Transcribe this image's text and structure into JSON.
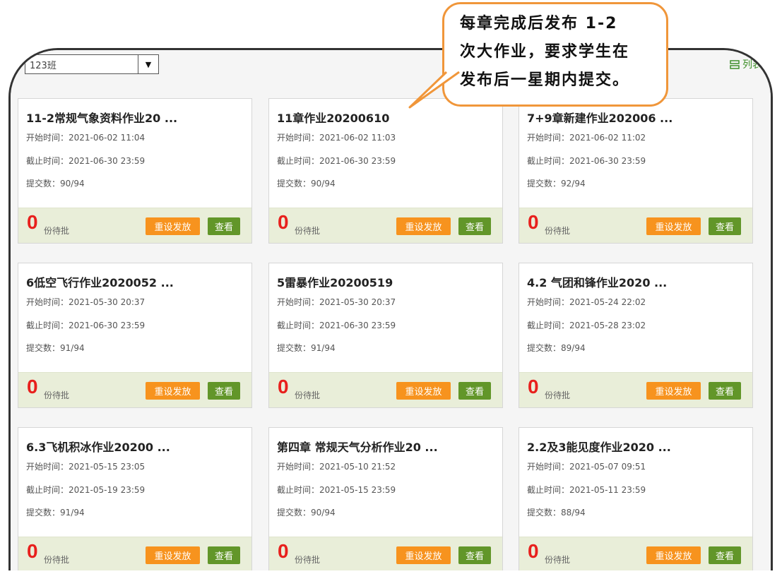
{
  "toolbar": {
    "class_select_value": "123班",
    "list_view_label": "列表"
  },
  "callout": {
    "lines": [
      "每章完成后发布 1-2",
      "次大作业，要求学生在",
      "发布后一星期内提交。"
    ]
  },
  "labels": {
    "start_prefix": "开始时间：",
    "end_prefix": "截止时间：",
    "submit_prefix": "提交数：",
    "pending_suffix": "份待批",
    "reset_button": "重设发放",
    "view_button": "查看"
  },
  "assignments": [
    {
      "title": "11-2常规气象资料作业20 ...",
      "start": "2021-06-02 11:04",
      "end": "2021-06-30 23:59",
      "submitted": "90/94",
      "pending": "0"
    },
    {
      "title": "11章作业20200610",
      "start": "2021-06-02 11:03",
      "end": "2021-06-30 23:59",
      "submitted": "90/94",
      "pending": "0"
    },
    {
      "title": "7+9章新建作业202006 ...",
      "start": "2021-06-02 11:02",
      "end": "2021-06-30 23:59",
      "submitted": "92/94",
      "pending": "0"
    },
    {
      "title": "6低空飞行作业2020052 ...",
      "start": "2021-05-30 20:37",
      "end": "2021-06-30 23:59",
      "submitted": "91/94",
      "pending": "0"
    },
    {
      "title": "5雷暴作业20200519",
      "start": "2021-05-30 20:37",
      "end": "2021-06-30 23:59",
      "submitted": "91/94",
      "pending": "0"
    },
    {
      "title": "4.2 气团和锋作业2020 ...",
      "start": "2021-05-24 22:02",
      "end": "2021-05-28 23:02",
      "submitted": "89/94",
      "pending": "0"
    },
    {
      "title": "6.3飞机积冰作业20200 ...",
      "start": "2021-05-15 23:05",
      "end": "2021-05-19 23:59",
      "submitted": "91/94",
      "pending": "0"
    },
    {
      "title": "第四章 常规天气分析作业20 ...",
      "start": "2021-05-10 21:52",
      "end": "2021-05-15 23:59",
      "submitted": "90/94",
      "pending": "0"
    },
    {
      "title": "2.2及3能见度作业2020 ...",
      "start": "2021-05-07 09:51",
      "end": "2021-05-11 23:59",
      "submitted": "88/94",
      "pending": "0"
    }
  ],
  "colors": {
    "accent_orange": "#f7931e",
    "view_green": "#629629",
    "pending_red": "#e8201d",
    "footer_bg": "#e9eed9",
    "callout_border": "#f0963a"
  },
  "icons": {
    "dropdown": "caret-down-icon",
    "list_view": "list-view-icon"
  }
}
